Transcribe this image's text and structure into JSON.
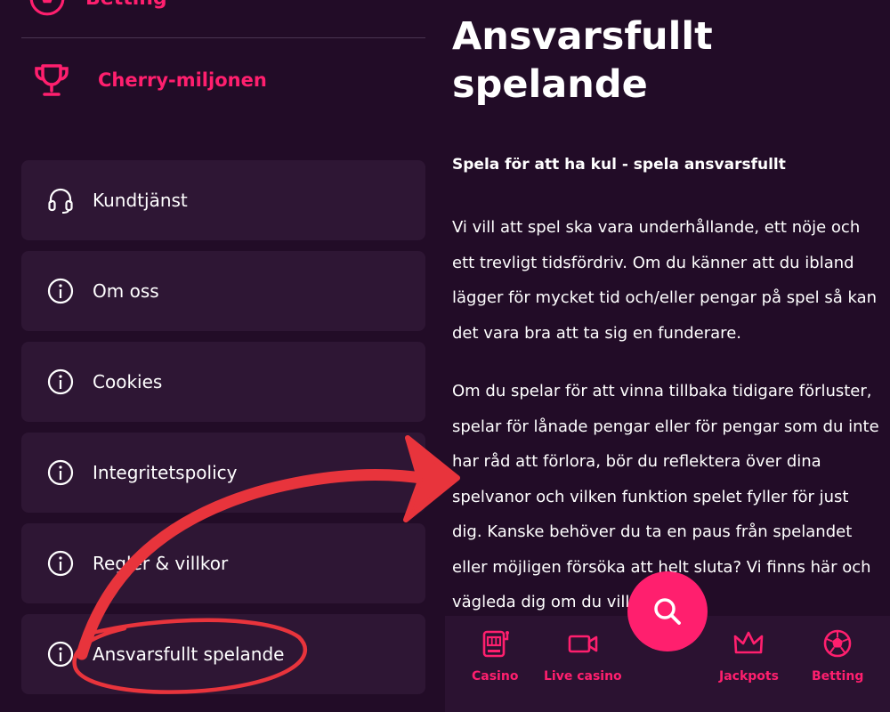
{
  "sidebar": {
    "betting_label": "Betting",
    "cherry_label": "Cherry-miljonen",
    "items": [
      {
        "label": "Kundtjänst",
        "icon": "headset-icon"
      },
      {
        "label": "Om oss",
        "icon": "info-icon"
      },
      {
        "label": "Cookies",
        "icon": "info-icon"
      },
      {
        "label": "Integritetspolicy",
        "icon": "info-icon"
      },
      {
        "label": "Regler & villkor",
        "icon": "info-icon"
      },
      {
        "label": "Ansvarsfullt spelande",
        "icon": "info-icon"
      }
    ]
  },
  "content": {
    "title": "Ansvarsfullt spelande",
    "subtitle": "Spela för att ha kul - spela ansvarsfullt",
    "paragraphs": [
      "Vi vill att spel ska vara underhållande, ett nöje och ett trevligt tidsfördriv. Om du känner att du ibland lägger för mycket tid och/eller pengar på spel så kan det vara bra att ta sig en funderare.",
      "Om du spelar för att vinna tillbaka tidigare förluster, spelar för lånade pengar eller för pengar som du inte har råd att förlora, bör du reflektera över dina spelvanor och vilken funktion spelet fyller för just dig. Kanske behöver du ta en paus från spelandet eller möjligen försöka att helt sluta? Vi finns här och vägleda dig om du vill."
    ]
  },
  "bottom_nav": {
    "items": [
      {
        "label": "Casino",
        "icon": "slot-machine-icon"
      },
      {
        "label": "Live casino",
        "icon": "video-camera-icon"
      },
      {
        "label": "Jackpots",
        "icon": "crown-icon"
      },
      {
        "label": "Betting",
        "icon": "football-icon"
      }
    ],
    "search_icon": "search-icon"
  },
  "colors": {
    "background": "#220c27",
    "card": "#2e1634",
    "accent": "#ff1f6e",
    "annotation": "#e8343c"
  }
}
